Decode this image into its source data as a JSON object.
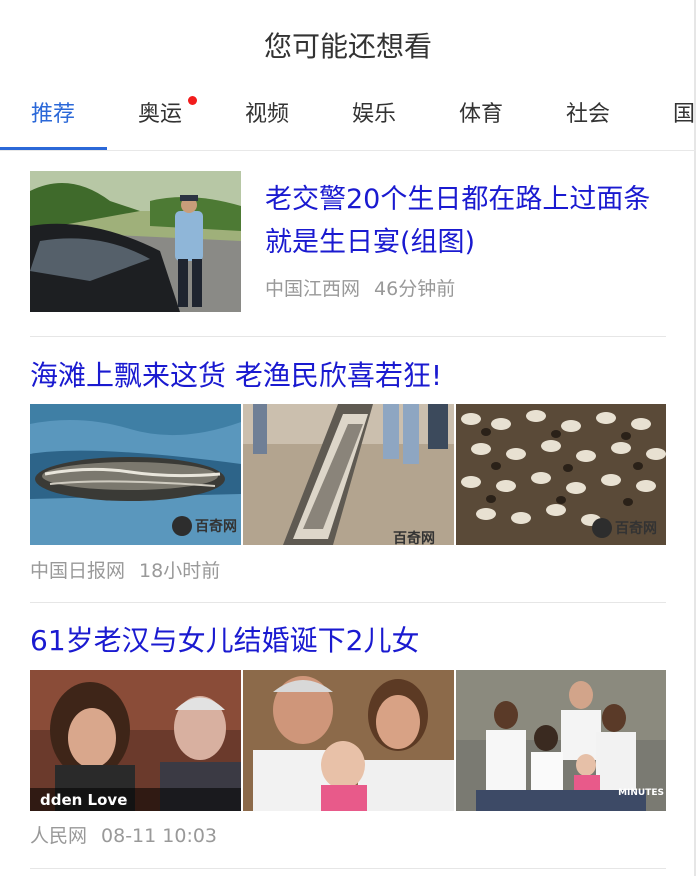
{
  "header": {
    "title": "您可能还想看"
  },
  "tabs": [
    {
      "label": "推荐",
      "active": true
    },
    {
      "label": "奥运",
      "badge": true
    },
    {
      "label": "视频"
    },
    {
      "label": "娱乐"
    },
    {
      "label": "体育"
    },
    {
      "label": "社会"
    },
    {
      "label": "国"
    }
  ],
  "articles": [
    {
      "title": "老交警20个生日都在路上过面条就是生日宴(组图)",
      "source": "中国江西网",
      "time": "46分钟前"
    },
    {
      "title": "海滩上飘来这货 老渔民欣喜若狂!",
      "source": "中国日报网",
      "time": "18小时前",
      "watermarks": [
        "百奇网",
        "百奇网",
        "百奇网"
      ]
    },
    {
      "title": "61岁老汉与女儿结婚诞下2儿女",
      "source": "人民网",
      "time": "08-11 10:03",
      "captions": [
        "dden Love",
        "MINUTES"
      ]
    }
  ],
  "colors": {
    "accent": "#2b68d8",
    "title_link": "#1a1ad0",
    "meta": "#999999",
    "badge": "#f21c1c"
  }
}
